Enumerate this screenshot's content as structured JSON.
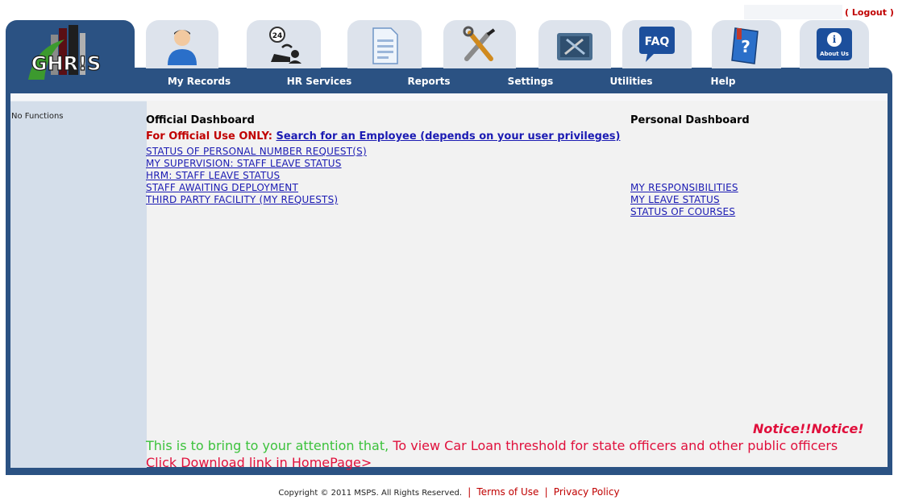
{
  "header": {
    "logo_text": "GHR!S",
    "logout_open": "(",
    "logout_label": "Logout",
    "logout_close": ")"
  },
  "nav": [
    {
      "label": "My Records",
      "icon": "user-icon"
    },
    {
      "label": "HR Services",
      "icon": "24-hour-service-icon"
    },
    {
      "label": "Reports",
      "icon": "document-icon"
    },
    {
      "label": "Settings",
      "icon": "tools-icon"
    },
    {
      "label": "Utilities",
      "icon": "toolbox-icon"
    },
    {
      "label": "Help",
      "icon": "help-book-icon"
    }
  ],
  "nav_extra_icons": [
    {
      "label": "FAQ",
      "icon": "faq-icon"
    },
    {
      "label": "About Us",
      "icon": "about-us-icon"
    }
  ],
  "sidebar": {
    "label": "No Functions"
  },
  "official": {
    "title": "Official Dashboard",
    "note_prefix": "For Official Use ONLY:",
    "note_link": "Search for an Employee (depends on your user privileges)",
    "links": [
      "STATUS OF PERSONAL NUMBER REQUEST(S)",
      "MY SUPERVISION: STAFF LEAVE STATUS",
      "HRM: STAFF LEAVE STATUS",
      "STAFF AWAITING DEPLOYMENT",
      "THIRD PARTY FACILITY (MY REQUESTS)"
    ]
  },
  "personal": {
    "title": "Personal Dashboard",
    "links": [
      "MY RESPONSIBILITIES",
      "MY LEAVE STATUS",
      "STATUS OF COURSES"
    ]
  },
  "notice": {
    "title": "Notice!!Notice!",
    "intro": "This is to bring to your attention that, ",
    "body": "To view Car Loan threshold for state officers and other public officers Click Download link in HomePage>"
  },
  "footer": {
    "copyright": "Copyright © 2011 MSPS. All Rights Reserved.",
    "terms": "Terms of Use",
    "privacy": "Privacy Policy",
    "sep": "|"
  },
  "colors": {
    "primary": "#2b5283",
    "tab_bg": "#dde3ec",
    "sidebar_bg": "#d4deea",
    "content_bg": "#f2f2f2",
    "link": "#1b1bb3",
    "alert": "#c00000",
    "notice_pink": "#e0103c",
    "notice_green": "#3cc23c"
  }
}
